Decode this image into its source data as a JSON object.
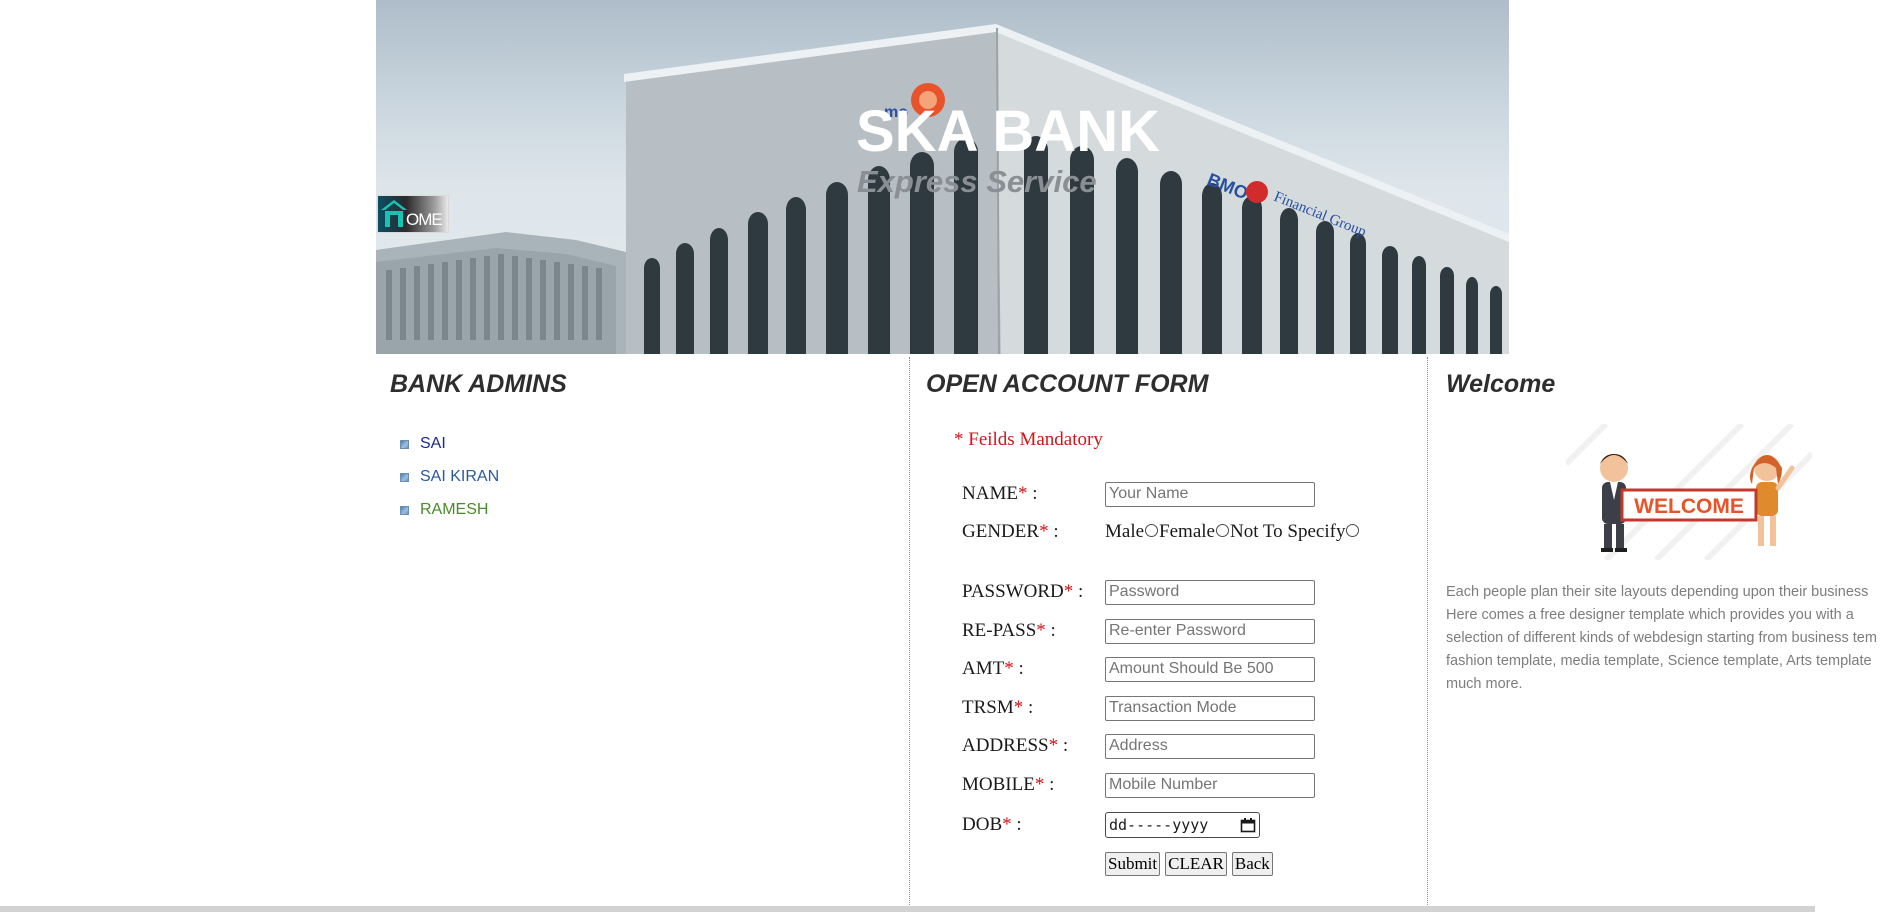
{
  "header": {
    "title": "SKA BANK",
    "subtitle": "Express Service",
    "home_button_text": "OME"
  },
  "admins": {
    "heading": "BANK ADMINS",
    "items": [
      {
        "label": "SAI",
        "color": "#1a2a8c"
      },
      {
        "label": "SAI KIRAN",
        "color": "#2a5a9c"
      },
      {
        "label": "RAMESH",
        "color": "#4a8a2a"
      }
    ]
  },
  "form": {
    "heading": "OPEN ACCOUNT FORM",
    "mandatory_note": "* Feilds Mandatory",
    "fields": {
      "name": {
        "label": "NAME",
        "placeholder": "Your Name"
      },
      "gender": {
        "label": "GENDER",
        "options": [
          "Male",
          "Female",
          "Not To Specify"
        ]
      },
      "password": {
        "label": "PASSWORD",
        "placeholder": "Password"
      },
      "repass": {
        "label": "RE-PASS",
        "placeholder": "Re-enter Password"
      },
      "amt": {
        "label": "AMT",
        "placeholder": "Amount Should Be 500"
      },
      "trsm": {
        "label": "TRSM",
        "placeholder": "Transaction Mode"
      },
      "address": {
        "label": "ADDRESS",
        "placeholder": "Address"
      },
      "mobile": {
        "label": "MOBILE",
        "placeholder": "Mobile Number"
      },
      "dob": {
        "label": "DOB",
        "value": "dd-----yyyy"
      }
    },
    "required_marker": "*",
    "label_suffix": " :",
    "buttons": {
      "submit": "Submit",
      "clear": "CLEAR",
      "back": "Back"
    }
  },
  "welcome": {
    "heading": "Welcome",
    "image_text": "WELCOME",
    "lines": [
      "Each people plan their site layouts depending upon their business",
      "Here comes a free designer template which provides you with a",
      "selection of different kinds of webdesign starting from business tem",
      "fashion template, media template, Science template, Arts template",
      "much more."
    ]
  },
  "colors": {
    "accent_red": "#d0161a",
    "heading_text": "#2e2e2e",
    "body_grey": "#7d7d7d"
  }
}
